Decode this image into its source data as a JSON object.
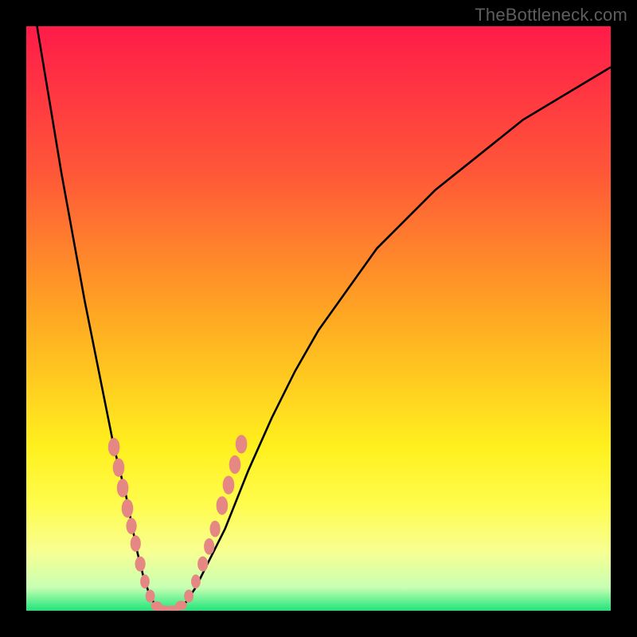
{
  "watermark": "TheBottleneck.com",
  "colors": {
    "gradient_stops": {
      "c0": "#ff1b49",
      "c1": "#ff5738",
      "c2": "#ffa922",
      "c3": "#fff01e",
      "c4": "#fffc4e",
      "c5": "#f7ff93",
      "c6": "#c8ffb3",
      "c7": "#1fe57a"
    },
    "curve": "#000000",
    "marker": "#e58782",
    "frame": "#000000"
  },
  "chart_data": {
    "type": "line",
    "title": "",
    "xlabel": "",
    "ylabel": "",
    "xlim": [
      0,
      100
    ],
    "ylim": [
      0,
      100
    ],
    "x": [
      0,
      2,
      4,
      6,
      8,
      10,
      12,
      14,
      15,
      16,
      17,
      18,
      19,
      20,
      21,
      22,
      23,
      24,
      25,
      27,
      29,
      31,
      34,
      38,
      42,
      46,
      50,
      55,
      60,
      65,
      70,
      75,
      80,
      85,
      90,
      95,
      100
    ],
    "series": [
      {
        "name": "bottleneck-curve",
        "values": [
          112,
          99,
          87,
          75,
          64,
          53,
          43,
          33,
          28,
          24,
          20,
          15,
          10,
          6,
          3,
          1,
          0,
          0,
          0,
          1,
          4,
          8,
          14,
          24,
          33,
          41,
          48,
          55,
          62,
          67,
          72,
          76,
          80,
          84,
          87,
          90,
          93
        ]
      }
    ],
    "markers": [
      {
        "x": 15.0,
        "y": 28.0,
        "rx": 1.0,
        "ry": 1.6
      },
      {
        "x": 15.8,
        "y": 24.5,
        "rx": 1.0,
        "ry": 1.6
      },
      {
        "x": 16.5,
        "y": 21.0,
        "rx": 1.0,
        "ry": 1.6
      },
      {
        "x": 17.3,
        "y": 17.5,
        "rx": 1.0,
        "ry": 1.6
      },
      {
        "x": 18.0,
        "y": 14.5,
        "rx": 0.9,
        "ry": 1.4
      },
      {
        "x": 18.7,
        "y": 11.5,
        "rx": 0.9,
        "ry": 1.4
      },
      {
        "x": 19.5,
        "y": 8.0,
        "rx": 0.9,
        "ry": 1.3
      },
      {
        "x": 20.3,
        "y": 5.0,
        "rx": 0.8,
        "ry": 1.2
      },
      {
        "x": 21.2,
        "y": 2.5,
        "rx": 0.8,
        "ry": 1.1
      },
      {
        "x": 22.3,
        "y": 0.8,
        "rx": 1.0,
        "ry": 0.8
      },
      {
        "x": 23.5,
        "y": 0.2,
        "rx": 1.2,
        "ry": 0.7
      },
      {
        "x": 25.0,
        "y": 0.2,
        "rx": 1.2,
        "ry": 0.7
      },
      {
        "x": 26.5,
        "y": 0.9,
        "rx": 1.0,
        "ry": 0.8
      },
      {
        "x": 27.8,
        "y": 2.5,
        "rx": 0.8,
        "ry": 1.1
      },
      {
        "x": 29.0,
        "y": 5.0,
        "rx": 0.8,
        "ry": 1.2
      },
      {
        "x": 30.2,
        "y": 8.0,
        "rx": 0.9,
        "ry": 1.3
      },
      {
        "x": 31.3,
        "y": 11.0,
        "rx": 0.9,
        "ry": 1.4
      },
      {
        "x": 32.3,
        "y": 14.0,
        "rx": 0.9,
        "ry": 1.4
      },
      {
        "x": 33.5,
        "y": 18.0,
        "rx": 1.0,
        "ry": 1.6
      },
      {
        "x": 34.6,
        "y": 21.5,
        "rx": 1.0,
        "ry": 1.6
      },
      {
        "x": 35.7,
        "y": 25.0,
        "rx": 1.0,
        "ry": 1.6
      },
      {
        "x": 36.8,
        "y": 28.5,
        "rx": 1.0,
        "ry": 1.6
      }
    ],
    "notes": "x/y are in 0–100 domain, origin bottom-left; values are visual estimates from an unlabeled plot."
  }
}
